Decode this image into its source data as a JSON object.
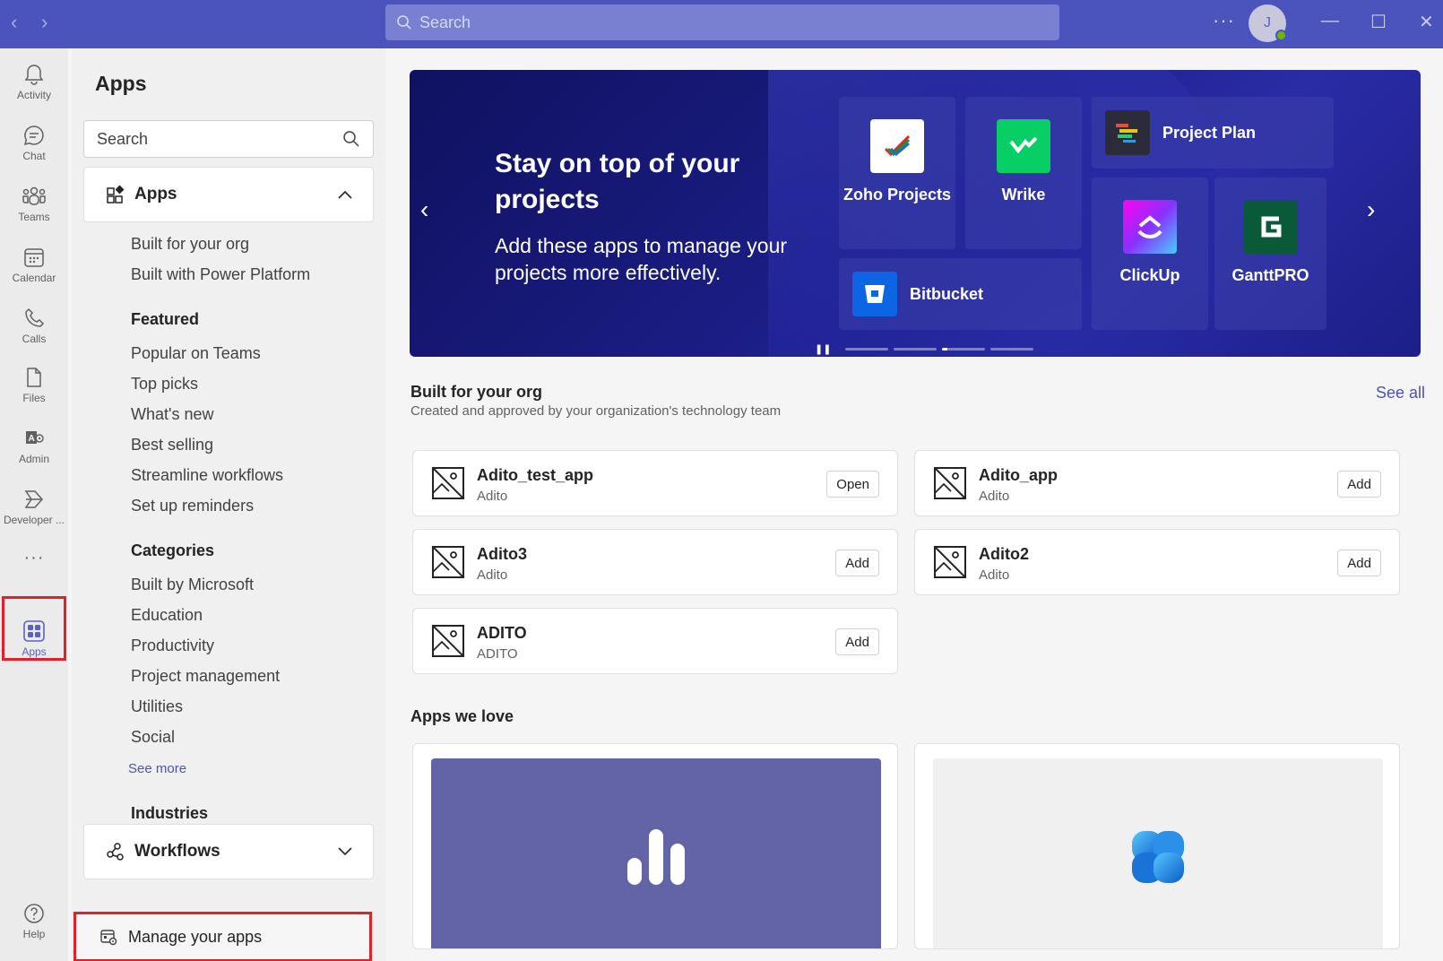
{
  "titlebar": {
    "search_placeholder": "Search",
    "more": "···",
    "avatar_initial": "J",
    "minimize": "—",
    "maximize": "☐",
    "close": "✕"
  },
  "rail": {
    "items": [
      {
        "label": "Activity",
        "icon": "bell-icon"
      },
      {
        "label": "Chat",
        "icon": "chat-icon"
      },
      {
        "label": "Teams",
        "icon": "teams-icon"
      },
      {
        "label": "Calendar",
        "icon": "calendar-icon"
      },
      {
        "label": "Calls",
        "icon": "phone-icon"
      },
      {
        "label": "Files",
        "icon": "file-icon"
      },
      {
        "label": "Admin",
        "icon": "admin-icon"
      },
      {
        "label": "Developer ...",
        "icon": "developer-icon"
      },
      {
        "label": "Apps",
        "icon": "apps-grid-icon"
      },
      {
        "label": "Help",
        "icon": "help-icon"
      }
    ],
    "more": "···"
  },
  "panel": {
    "title": "Apps",
    "search_placeholder": "Search",
    "apps_section": "Apps",
    "apps_links": [
      "Built for your org",
      "Built with Power Platform"
    ],
    "featured_head": "Featured",
    "featured_links": [
      "Popular on Teams",
      "Top picks",
      "What's new",
      "Best selling",
      "Streamline workflows",
      "Set up reminders"
    ],
    "categories_head": "Categories",
    "categories_links": [
      "Built by Microsoft",
      "Education",
      "Productivity",
      "Project management",
      "Utilities",
      "Social"
    ],
    "see_more": "See more",
    "industries_head": "Industries",
    "workflows_section": "Workflows",
    "manage": "Manage your apps"
  },
  "hero": {
    "title": "Stay on top of your projects",
    "subtitle": "Add these apps to manage your projects more effectively.",
    "tiles": [
      {
        "name": "Zoho Projects",
        "color": "#ffffff"
      },
      {
        "name": "Wrike",
        "color": "#08cf65"
      },
      {
        "name": "Project Plan",
        "color": "#2b2b3a"
      },
      {
        "name": "Bitbucket",
        "color": "#0c66e4"
      },
      {
        "name": "ClickUp",
        "color": "#7b68ee"
      },
      {
        "name": "GanttPRO",
        "color": "#0a5a3a"
      }
    ]
  },
  "built_for_org": {
    "title": "Built for your org",
    "subtitle": "Created and approved by your organization's technology team",
    "see_all": "See all",
    "apps": [
      {
        "name": "Adito_test_app",
        "publisher": "Adito",
        "action": "Open"
      },
      {
        "name": "Adito_app",
        "publisher": "Adito",
        "action": "Add"
      },
      {
        "name": "Adito3",
        "publisher": "Adito",
        "action": "Add"
      },
      {
        "name": "Adito2",
        "publisher": "Adito",
        "action": "Add"
      },
      {
        "name": "ADITO",
        "publisher": "ADITO",
        "action": "Add"
      }
    ]
  },
  "apps_we_love": {
    "title": "Apps we love",
    "colors": [
      "#6264a7",
      "#f0f0f0"
    ]
  }
}
